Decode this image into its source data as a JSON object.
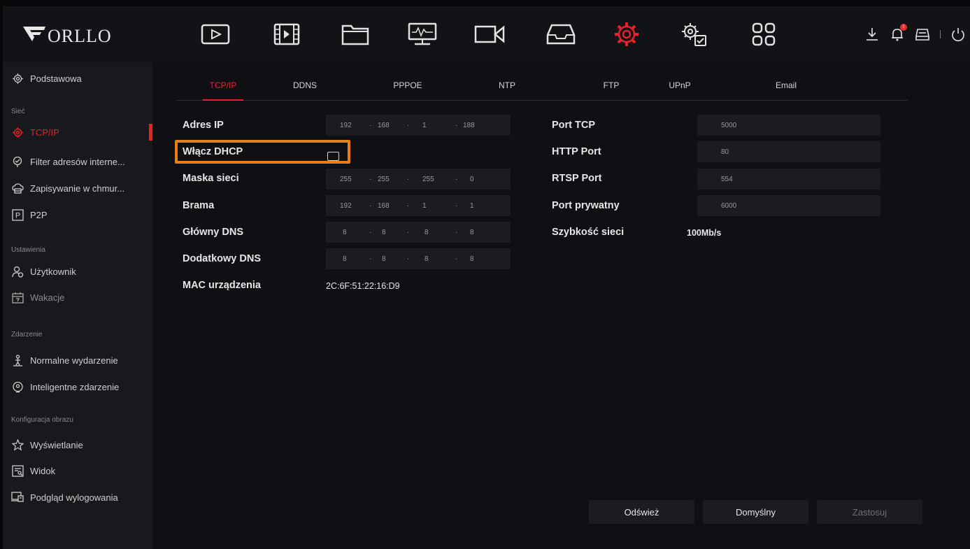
{
  "brand": {
    "logo_text": "ORLLO",
    "accent": "#e8202a",
    "highlight": "#e87e16"
  },
  "topbar": {
    "icons": [
      "playback-icon",
      "video-clip-icon",
      "folder-icon",
      "monitor-icon",
      "camera-icon",
      "storage-icon",
      "settings-gear-icon",
      "system-gears-icon",
      "grid-menu-icon"
    ],
    "right_icons": [
      "download-icon",
      "alarm-bell-icon",
      "disk-icon",
      "power-icon"
    ],
    "badge": "!"
  },
  "sidebar": {
    "item_basic": "Podstawowa",
    "section_network": "Sieć",
    "item_tcpip": "TCP/IP",
    "item_filter": "Filter adresów interne...",
    "item_cloud": "Zapisywanie w chmur...",
    "item_p2p": "P2P",
    "p2p_icon_letter": "P",
    "section_settings": "Ustawienia",
    "item_user": "Użytkownik",
    "item_holiday": "Wakacje",
    "section_event": "Zdarzenie",
    "item_normal_event": "Normalne wydarzenie",
    "item_smart_event": "Inteligentne zdarzenie",
    "section_image": "Konfiguracja obrazu",
    "item_display": "Wyświetlanie",
    "item_view": "Widok",
    "item_logout_preview": "Podgląd wylogowania"
  },
  "tabs": {
    "tcpip": "TCP/IP",
    "ddns": "DDNS",
    "pppoe": "PPPOE",
    "ntp": "NTP",
    "ftp": "FTP",
    "upnp": "UPnP",
    "email": "Email"
  },
  "form": {
    "ip_label": "Adres IP",
    "ip": [
      "192",
      "168",
      "1",
      "188"
    ],
    "dhcp_label": "Włącz DHCP",
    "dhcp_checked": false,
    "mask_label": "Maska sieci",
    "mask": [
      "255",
      "255",
      "255",
      "0"
    ],
    "gateway_label": "Brama",
    "gateway": [
      "192",
      "168",
      "1",
      "1"
    ],
    "dns1_label": "Główny DNS",
    "dns1": [
      "8",
      "8",
      "8",
      "8"
    ],
    "dns2_label": "Dodatkowy DNS",
    "dns2": [
      "8",
      "8",
      "8",
      "8"
    ],
    "mac_label": "MAC urządzenia",
    "mac_value": "2C:6F:51:22:16:D9",
    "dot": "·",
    "tcp_port_label": "Port TCP",
    "tcp_port": "5000",
    "http_port_label": "HTTP Port",
    "http_port": "80",
    "rtsp_port_label": "RTSP Port",
    "rtsp_port": "554",
    "private_port_label": "Port prywatny",
    "private_port": "6000",
    "speed_label": "Szybkość sieci",
    "speed_value": "100Mb/s"
  },
  "buttons": {
    "refresh": "Odśwież",
    "default": "Domyślny",
    "apply": "Zastosuj"
  }
}
